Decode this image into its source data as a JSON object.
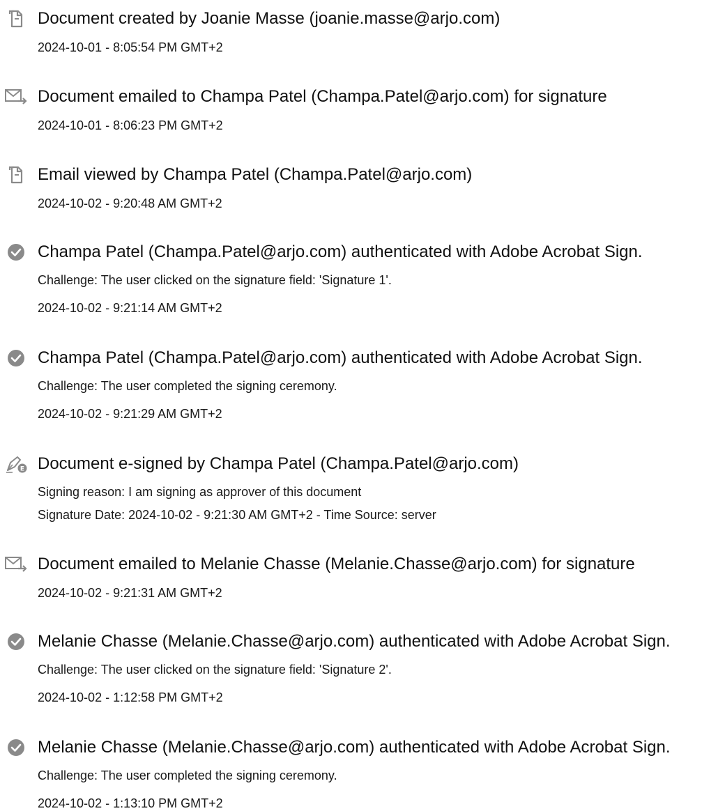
{
  "events": [
    {
      "icon": "document-icon",
      "title": "Document created by Joanie Masse (joanie.masse@arjo.com)",
      "details": [
        "2024-10-01 - 8:05:54 PM GMT+2"
      ]
    },
    {
      "icon": "email-forward-icon",
      "title": "Document emailed to Champa Patel (Champa.Patel@arjo.com) for signature",
      "details": [
        "2024-10-01 - 8:06:23 PM GMT+2"
      ]
    },
    {
      "icon": "document-icon",
      "title": "Email viewed by Champa Patel (Champa.Patel@arjo.com)",
      "details": [
        "2024-10-02 - 9:20:48 AM GMT+2"
      ]
    },
    {
      "icon": "check-circle-icon",
      "title": "Champa Patel (Champa.Patel@arjo.com) authenticated with Adobe Acrobat Sign.",
      "details": [
        "Challenge: The user clicked on the signature field: 'Signature 1'.",
        "2024-10-02 - 9:21:14 AM GMT+2"
      ]
    },
    {
      "icon": "check-circle-icon",
      "title": "Champa Patel (Champa.Patel@arjo.com) authenticated with Adobe Acrobat Sign.",
      "details": [
        "Challenge: The user completed the signing ceremony.",
        "2024-10-02 - 9:21:29 AM GMT+2"
      ]
    },
    {
      "icon": "pen-esign-icon",
      "title": "Document e-signed by Champa Patel (Champa.Patel@arjo.com)",
      "details": [
        "Signing reason: I am signing as approver of this document",
        "Signature Date: 2024-10-02 - 9:21:30 AM GMT+2 - Time Source: server"
      ]
    },
    {
      "icon": "email-forward-icon",
      "title": "Document emailed to Melanie Chasse (Melanie.Chasse@arjo.com) for signature",
      "details": [
        "2024-10-02 - 9:21:31 AM GMT+2"
      ]
    },
    {
      "icon": "check-circle-icon",
      "title": "Melanie Chasse (Melanie.Chasse@arjo.com) authenticated with Adobe Acrobat Sign.",
      "details": [
        "Challenge: The user clicked on the signature field: 'Signature 2'.",
        "2024-10-02 - 1:12:58 PM GMT+2"
      ]
    },
    {
      "icon": "check-circle-icon",
      "title": "Melanie Chasse (Melanie.Chasse@arjo.com) authenticated with Adobe Acrobat Sign.",
      "details": [
        "Challenge: The user completed the signing ceremony.",
        "2024-10-02 - 1:13:10 PM GMT+2"
      ]
    }
  ]
}
